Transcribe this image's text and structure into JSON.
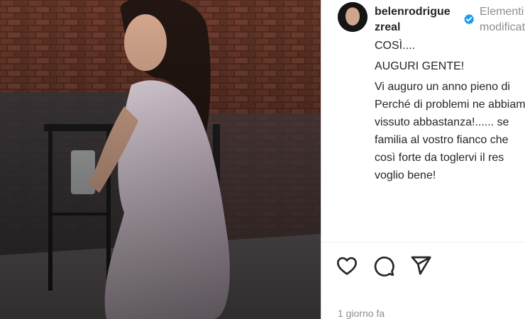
{
  "post": {
    "username": "belenrodriguezreal",
    "username_line1": "belenrodrigue",
    "username_line2": "zreal",
    "edited_line1": "Elementi",
    "edited_line2": "modificati",
    "caption_lines": [
      "COSÌ....",
      "AUGURI GENTE!",
      "Vi auguro un anno pieno di",
      "Perché di problemi ne abbiamo",
      "vissuto abbastanza!...... se",
      "familia al vostro fianco che",
      "così forte da toglervi il res",
      "voglio bene!"
    ],
    "timestamp": "1 giorno fa"
  },
  "icons": {
    "like": "heart-icon",
    "comment": "comment-icon",
    "share": "share-icon",
    "verified": "verified-badge-icon"
  },
  "colors": {
    "verified": "#1d9bf0",
    "text": "#262626",
    "muted": "#8e8e8e"
  }
}
